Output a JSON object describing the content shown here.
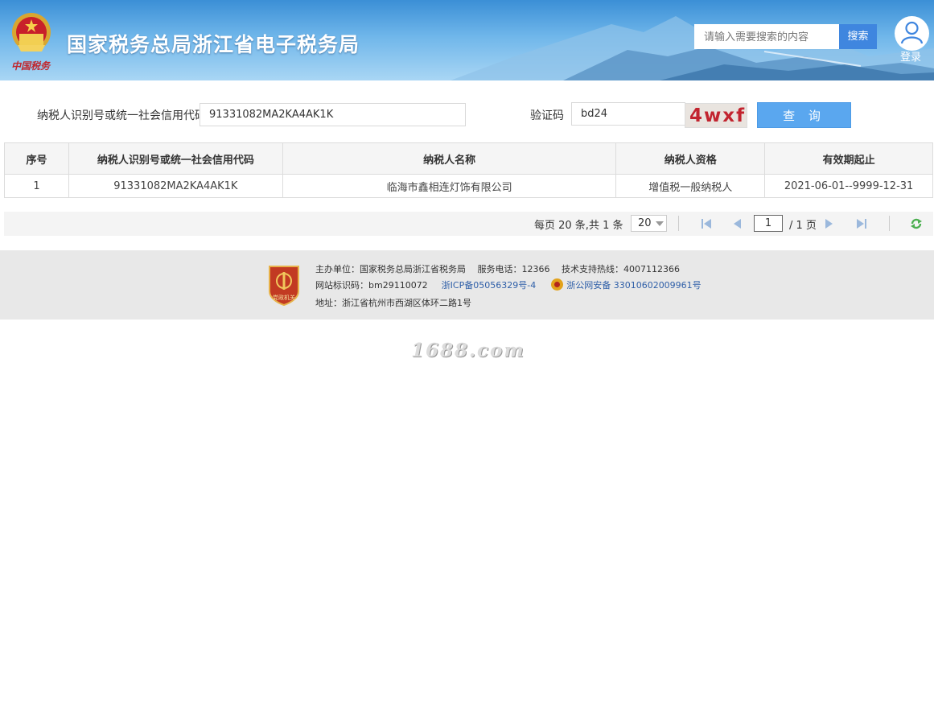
{
  "header": {
    "site_title": "国家税务总局浙江省电子税务局",
    "search_placeholder": "请输入需要搜索的内容",
    "search_button": "搜索",
    "login_label": "登录",
    "emblem_text": "中国税务"
  },
  "query": {
    "taxpayer_id_label": "纳税人识别号或统一社会信用代码",
    "taxpayer_id_value": "91331082MA2KA4AK1K",
    "captcha_label": "验证码",
    "captcha_value": "bd24",
    "captcha_image_text": "4wxf",
    "query_button": "查 询"
  },
  "table": {
    "columns": [
      "序号",
      "纳税人识别号或统一社会信用代码",
      "纳税人名称",
      "纳税人资格",
      "有效期起止"
    ],
    "rows": [
      [
        "1",
        "91331082MA2KA4AK1K",
        "临海市鑫相连灯饰有限公司",
        "增值税一般纳税人",
        "2021-06-01--9999-12-31"
      ]
    ]
  },
  "pager": {
    "info": "每页 20 条,共 1 条",
    "page_size": "20",
    "current_page": "1",
    "total_pages": "/ 1 页"
  },
  "footer": {
    "line1": "主办单位：国家税务总局浙江省税务局　 服务电话：12366　 技术支持热线：4007112366",
    "site_id": "网站标识码：bm29110072",
    "icp": "浙ICP备05056329号-4",
    "police_record": "浙公网安备 33010602009961号",
    "address": "地址：浙江省杭州市西湖区体环二路1号",
    "badge_text": "党政机关"
  },
  "watermark": "1688.com",
  "colors": {
    "banner": "#4a9be0",
    "primary_button": "#5aa7ef",
    "search_button": "#3f86df",
    "captcha_text": "#c2242f",
    "footer_bg": "#e8e8e8"
  }
}
